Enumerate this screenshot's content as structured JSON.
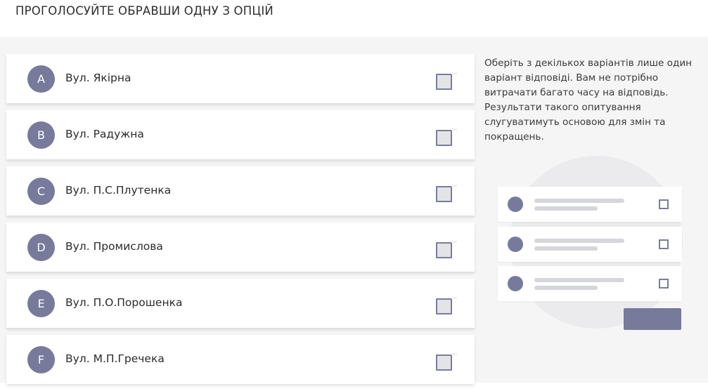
{
  "header": {
    "title": "ПРОГОЛОСУЙТЕ ОБРАВШИ ОДНУ З ОПЦІЙ"
  },
  "colors": {
    "accent": "#787a9b",
    "background": "#f5f5f6",
    "card": "#ffffff"
  },
  "options": [
    {
      "letter": "A",
      "label": "Вул. Якірна",
      "checked": false
    },
    {
      "letter": "B",
      "label": "Вул. Радужна",
      "checked": false
    },
    {
      "letter": "C",
      "label": "Вул. П.С.Плутенка",
      "checked": false
    },
    {
      "letter": "D",
      "label": "Вул. Промислова",
      "checked": false
    },
    {
      "letter": "E",
      "label": "Вул. П.О.Порошенка",
      "checked": false
    },
    {
      "letter": "F",
      "label": "Вул. М.П.Гречека",
      "checked": false
    }
  ],
  "hint": {
    "text": "Оберіть з декількох варіантів лише один варіант відповіді. Вам не потрібно витрачати багато часу на відповідь. Результати такого опитування слугуватимуть основою для змін та покращень."
  }
}
